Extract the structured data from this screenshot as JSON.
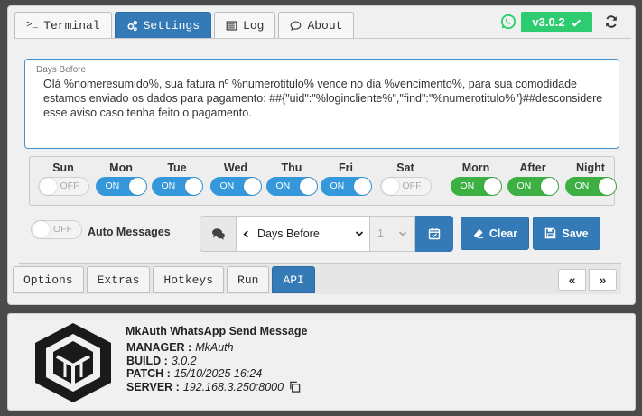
{
  "header": {
    "tabs": [
      {
        "label": "Terminal",
        "icon": "terminal-icon"
      },
      {
        "label": "Settings",
        "icon": "cogs-icon",
        "active": true
      },
      {
        "label": "Log",
        "icon": "list-icon"
      },
      {
        "label": "About",
        "icon": "chat-bubble-icon"
      }
    ],
    "version": "v3.0.2",
    "colors": {
      "accent": "#337ab7",
      "success": "#2ecc71",
      "whatsapp": "#25d366"
    }
  },
  "message": {
    "label": "Days Before",
    "text": "Olá %nomeresumido%, sua fatura nº %numerotitulo% vence no dia %vencimento%, para sua comodidade estamos enviado os dados para pagamento: ##{\"uid\":\"%logincliente%\",\"find\":\"%numerotitulo%\"}##desconsidere esse aviso caso tenha feito o pagamento."
  },
  "schedule": {
    "days": [
      {
        "label": "Sun",
        "state": "OFF"
      },
      {
        "label": "Mon",
        "state": "ON"
      },
      {
        "label": "Tue",
        "state": "ON"
      },
      {
        "label": "Wed",
        "state": "ON"
      },
      {
        "label": "Thu",
        "state": "ON"
      },
      {
        "label": "Fri",
        "state": "ON"
      },
      {
        "label": "Sat",
        "state": "OFF"
      }
    ],
    "periods": [
      {
        "label": "Morn",
        "state": "ON"
      },
      {
        "label": "After",
        "state": "ON"
      },
      {
        "label": "Night",
        "state": "ON"
      }
    ]
  },
  "controls": {
    "auto_toggle": "OFF",
    "auto_label": "Auto Messages",
    "type_select": "Days Before",
    "number_select": "1",
    "clear_label": "Clear",
    "save_label": "Save"
  },
  "bottom_tabs": [
    {
      "label": "Options"
    },
    {
      "label": "Extras"
    },
    {
      "label": "Hotkeys"
    },
    {
      "label": "Run"
    },
    {
      "label": "API",
      "active": true
    }
  ],
  "pager": {
    "prev": "«",
    "next": "»"
  },
  "info": {
    "title": "MkAuth WhatsApp Send Message",
    "manager_key": "MANAGER :",
    "manager": "MkAuth",
    "build_key": "BUILD :",
    "build": "3.0.2",
    "patch_key": "PATCH :",
    "patch": "15/10/2025 16:24",
    "server_key": "SERVER :",
    "server": "192.168.3.250:8000"
  }
}
